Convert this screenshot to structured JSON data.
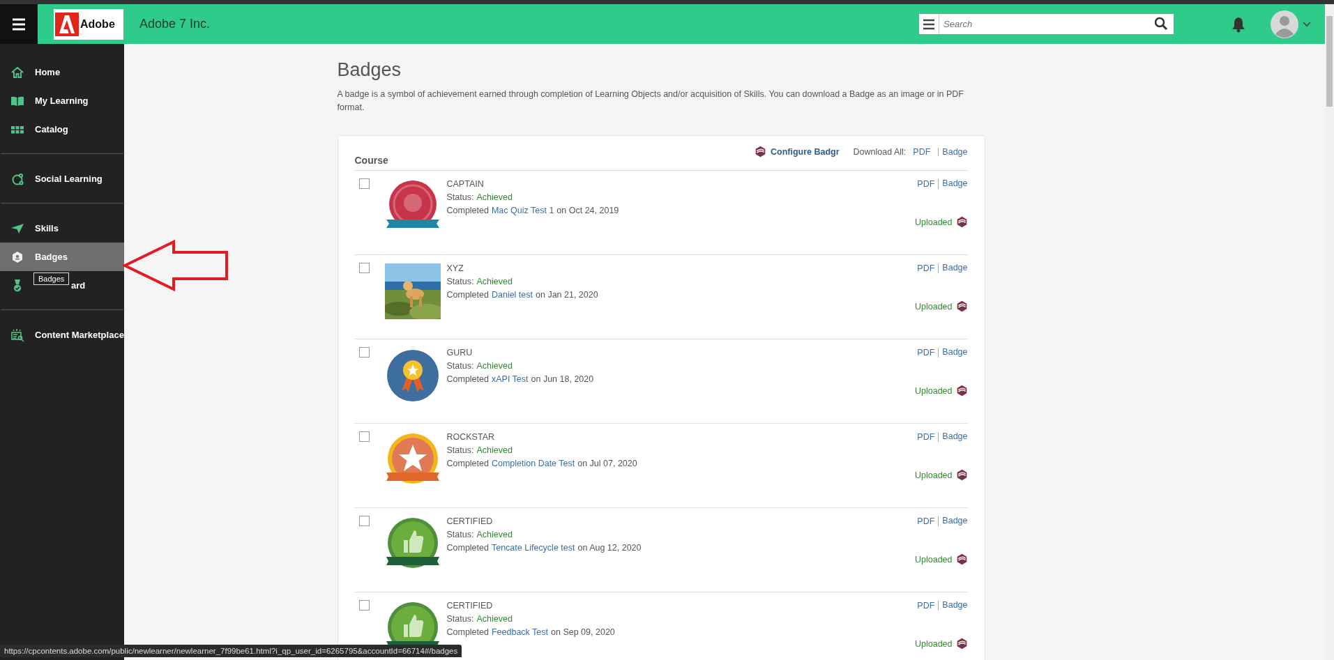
{
  "header": {
    "logo": "Adobe",
    "company": "Adobe 7 Inc.",
    "search": {
      "placeholder": "Search"
    }
  },
  "sidebar": {
    "groups": [
      {
        "items": [
          {
            "label": "Home",
            "selected": false
          },
          {
            "label": "My Learning",
            "selected": false
          },
          {
            "label": "Catalog",
            "selected": false
          }
        ]
      },
      {
        "items": [
          {
            "label": "Social Learning",
            "selected": false
          }
        ]
      },
      {
        "items": [
          {
            "label": "Skills",
            "selected": false
          },
          {
            "label": "Badges",
            "selected": true
          },
          {
            "label": "ard",
            "selected": false,
            "tooltip": "Badges"
          }
        ]
      },
      {
        "items": [
          {
            "label": "Content Marketplace",
            "selected": false
          }
        ]
      }
    ]
  },
  "page": {
    "title": "Badges",
    "description": "A badge is a symbol of achievement earned through completion of Learning Objects and/or acquisition of Skills. You can download a Badge as an image or in PDF format."
  },
  "card": {
    "heading": "Course",
    "configure": "Configure Badgr",
    "download_all": "Download All:",
    "pdf": "PDF",
    "badge": "Badge",
    "rows": [
      {
        "name": "CAPTAIN",
        "status_label": "Status:",
        "status": "Achieved",
        "completed": "Completed",
        "course": "Mac Quiz Test 1",
        "date": "on Oct 24, 2019",
        "checked": false,
        "kind": "medal",
        "color": "#c8344a",
        "pdf": "PDF",
        "badge": "Badge",
        "upload": "Uploaded"
      },
      {
        "name": "XYZ",
        "status_label": "Status:",
        "status": "Achieved",
        "completed": "Completed",
        "course": "Daniel test",
        "date": "on Jan 21, 2020",
        "checked": false,
        "kind": "picture",
        "pdf": "PDF",
        "badge": "Badge",
        "upload": "Uploaded"
      },
      {
        "name": "GURU",
        "status_label": "Status:",
        "status": "Achieved",
        "completed": "Completed",
        "course": "xAPI Test",
        "date": "on Jun 18, 2020",
        "checked": false,
        "kind": "ribbon",
        "color": "#3d6e9e",
        "pdf": "PDF",
        "badge": "Badge",
        "upload": "Uploaded"
      },
      {
        "name": "ROCKSTAR",
        "status_label": "Status:",
        "status": "Achieved",
        "completed": "Completed",
        "course": "Completion Date Test",
        "date": "on Jul 07, 2020",
        "checked": false,
        "kind": "star",
        "color": "#f2b51c",
        "pdf": "PDF",
        "badge": "Badge",
        "upload": "Uploaded"
      },
      {
        "name": "CERTIFIED",
        "status_label": "Status:",
        "status": "Achieved",
        "completed": "Completed",
        "course": "Tencate Lifecycle test",
        "date": "on Aug 12, 2020",
        "checked": false,
        "kind": "thumb",
        "color": "#4e8f3a",
        "pdf": "PDF",
        "badge": "Badge",
        "upload": "Uploaded"
      },
      {
        "name": "CERTIFIED",
        "status_label": "Status:",
        "status": "Achieved",
        "completed": "Completed",
        "course": "Feedback Test",
        "date": "on Sep 09, 2020",
        "checked": false,
        "kind": "thumb",
        "color": "#4e8f3a",
        "pdf": "PDF",
        "badge": "Badge",
        "upload": "Uploaded"
      }
    ]
  },
  "status_bar": {
    "url": "https://cpcontents.adobe.com/public/newlearner/newlearner_7f99be61.html?i_qp_user_id=6265795&accountId=66714#/badges"
  }
}
